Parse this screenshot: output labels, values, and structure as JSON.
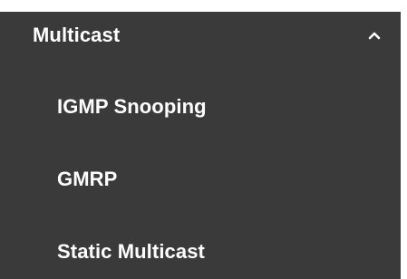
{
  "menu": {
    "group": {
      "title": "Multicast",
      "expanded": true,
      "toggle_icon": "chevron-up-icon"
    },
    "items": [
      {
        "label": "IGMP Snooping"
      },
      {
        "label": "GMRP"
      },
      {
        "label": "Static Multicast"
      }
    ],
    "colors": {
      "background": "#3a3a3a",
      "text": "#ffffff"
    }
  }
}
